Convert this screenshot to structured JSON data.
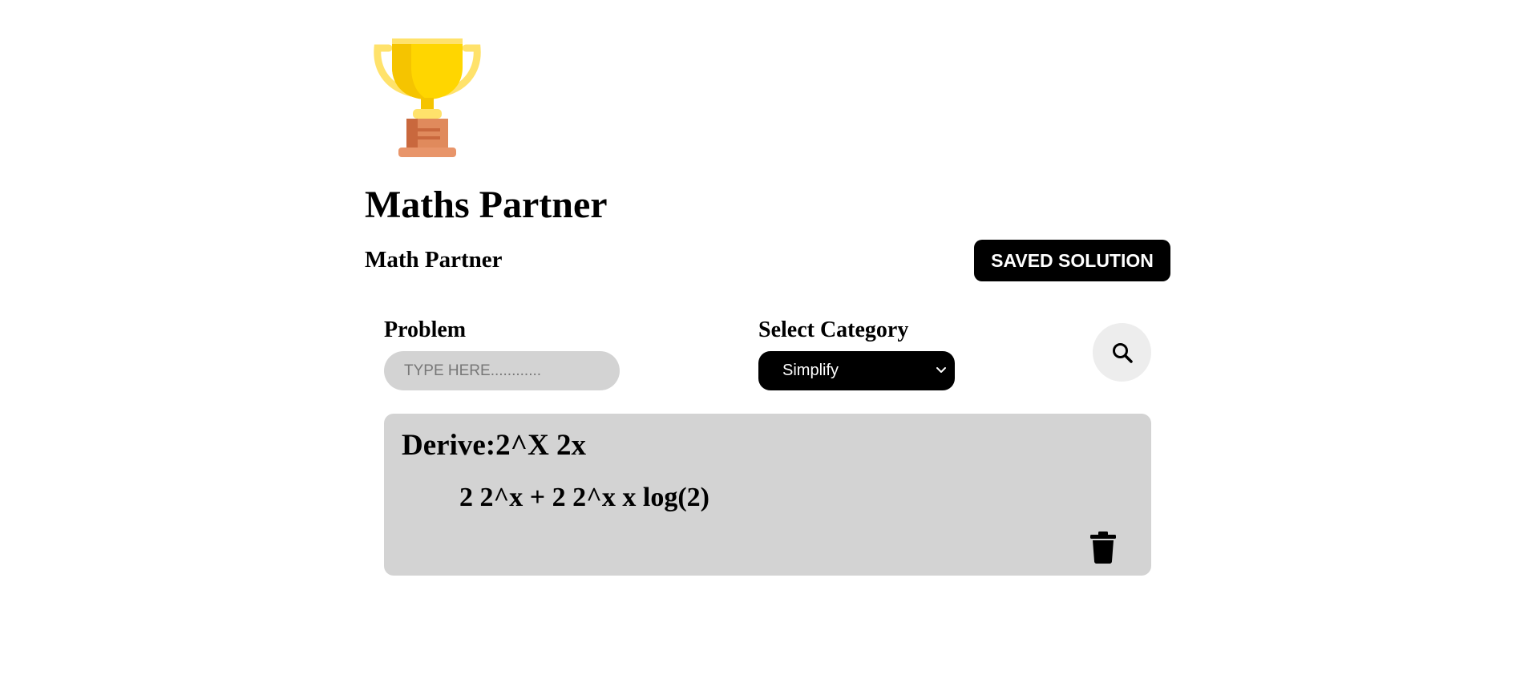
{
  "header": {
    "logo_icon": "trophy-icon",
    "title": "Maths Partner",
    "subtitle": "Math Partner",
    "saved_button_label": "SAVED SOLUTION"
  },
  "form": {
    "problem_label": "Problem",
    "problem_placeholder": "TYPE HERE............",
    "problem_value": "",
    "category_label": "Select Category",
    "category_selected": "Simplify",
    "search_icon": "search-icon"
  },
  "solutions": [
    {
      "problem": "Derive:2^X 2x",
      "answer": "2 2^x + 2 2^x x log(2)",
      "delete_icon": "trash-icon"
    }
  ],
  "colors": {
    "accent": "#000000",
    "card_background": "#d3d3d3",
    "input_background": "#d3d3d3",
    "search_button_background": "#ededed",
    "trophy_gold": "#ffd600",
    "trophy_base": "#d8784b"
  }
}
